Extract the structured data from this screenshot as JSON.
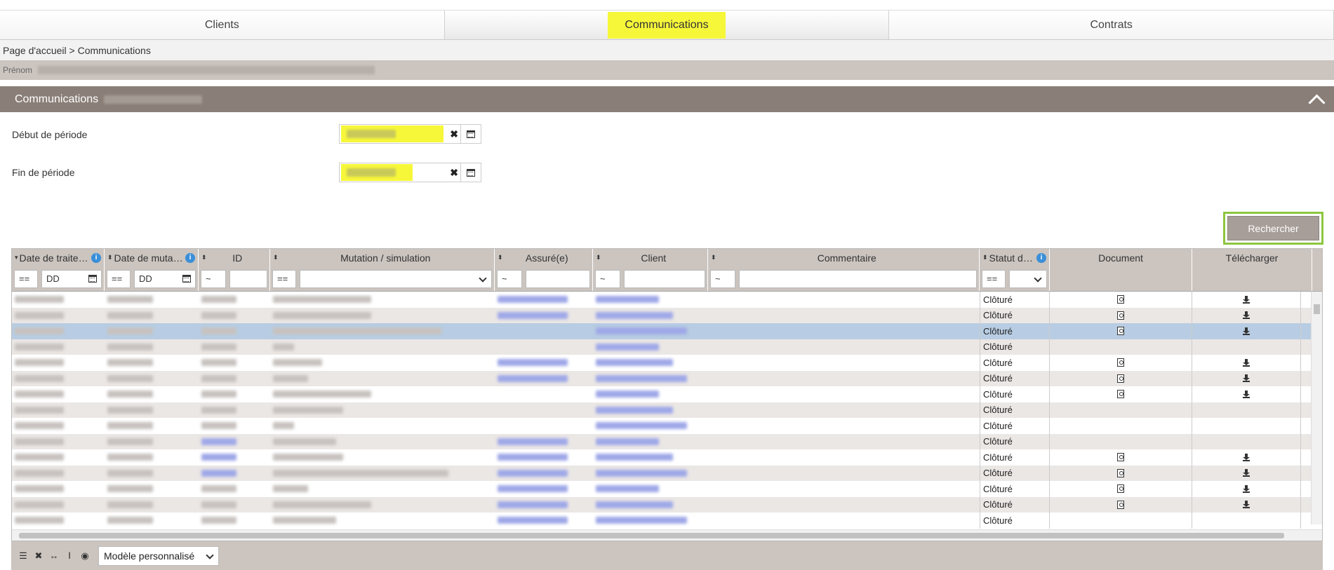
{
  "tabs": [
    {
      "label": "Clients",
      "active": false
    },
    {
      "label": "Communications",
      "active": true,
      "highlighted": true
    },
    {
      "label": "Contrats",
      "active": false
    }
  ],
  "breadcrumb": "Page d'accueil > Communications",
  "user_bar": {
    "label": "Prénom"
  },
  "panel": {
    "title": "Communications",
    "collapse_icon": "chevron-up-icon"
  },
  "form": {
    "start": {
      "label": "Début de période",
      "value": ""
    },
    "end": {
      "label": "Fin de période",
      "value": ""
    }
  },
  "search_button": "Rechercher",
  "table": {
    "columns": [
      {
        "label": "Date de traite…",
        "info": true
      },
      {
        "label": "Date de muta…",
        "info": true
      },
      {
        "label": "ID"
      },
      {
        "label": "Mutation / simulation"
      },
      {
        "label": "Assuré(e)"
      },
      {
        "label": "Client"
      },
      {
        "label": "Commentaire"
      },
      {
        "label": "Statut de…",
        "info": true
      },
      {
        "label": "Document"
      },
      {
        "label": "Télécharger"
      }
    ],
    "filters": {
      "date1_op": "==",
      "date1_placeholder": "DD",
      "date2_op": "==",
      "date2_placeholder": "DD",
      "id_op": "~",
      "mutation_op": "==",
      "assure_op": "~",
      "client_op": "~",
      "commentaire_op": "~",
      "statut_op": "=="
    },
    "rows": [
      {
        "statut": "Clôturé",
        "doc": true,
        "dl": true,
        "assure": true,
        "id_link": false,
        "mut_w": 140
      },
      {
        "statut": "Clôturé",
        "doc": true,
        "dl": true,
        "assure": true,
        "id_link": false,
        "mut_w": 140
      },
      {
        "statut": "Clôturé",
        "doc": true,
        "dl": true,
        "assure": false,
        "id_link": false,
        "mut_w": 240,
        "selected": true
      },
      {
        "statut": "Clôturé",
        "doc": false,
        "dl": false,
        "assure": false,
        "id_link": false,
        "mut_w": 30
      },
      {
        "statut": "Clôturé",
        "doc": true,
        "dl": true,
        "assure": true,
        "id_link": false,
        "mut_w": 70
      },
      {
        "statut": "Clôturé",
        "doc": true,
        "dl": true,
        "assure": true,
        "id_link": false,
        "mut_w": 50
      },
      {
        "statut": "Clôturé",
        "doc": true,
        "dl": true,
        "assure": false,
        "id_link": false,
        "mut_w": 140
      },
      {
        "statut": "Clôturé",
        "doc": false,
        "dl": false,
        "assure": false,
        "id_link": false,
        "mut_w": 100
      },
      {
        "statut": "Clôturé",
        "doc": false,
        "dl": false,
        "assure": false,
        "id_link": false,
        "mut_w": 30
      },
      {
        "statut": "Clôturé",
        "doc": false,
        "dl": false,
        "assure": true,
        "id_link": true,
        "mut_w": 90
      },
      {
        "statut": "Clôturé",
        "doc": true,
        "dl": true,
        "assure": true,
        "id_link": true,
        "mut_w": 100
      },
      {
        "statut": "Clôturé",
        "doc": true,
        "dl": true,
        "assure": true,
        "id_link": true,
        "mut_w": 250
      },
      {
        "statut": "Clôturé",
        "doc": true,
        "dl": true,
        "assure": true,
        "id_link": false,
        "mut_w": 50
      },
      {
        "statut": "Clôturé",
        "doc": true,
        "dl": true,
        "assure": true,
        "id_link": false,
        "mut_w": 140
      },
      {
        "statut": "Clôturé",
        "doc": false,
        "dl": false,
        "assure": true,
        "id_link": false,
        "mut_w": 90
      }
    ]
  },
  "footer": {
    "icons": [
      "list-icon",
      "close-icon",
      "resize-columns-icon",
      "text-height-icon",
      "eye-icon"
    ],
    "model_select": "Modèle personnalisé"
  }
}
